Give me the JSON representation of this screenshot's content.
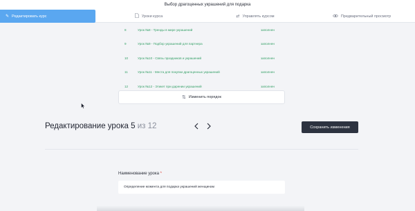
{
  "course_title": "Выбор драгоценных украшений для подарка",
  "tabs": [
    {
      "label": "Редактировать курс",
      "icon": "pencil-icon"
    },
    {
      "label": "Уроки курса",
      "icon": "document-icon"
    },
    {
      "label": "Управлять курсом",
      "icon": "swap-icon"
    },
    {
      "label": "Предварительный просмотр",
      "icon": "eye-icon"
    }
  ],
  "lessons": [
    {
      "num": "8",
      "title": "Урок №8 - Тренды в мире украшений",
      "status": "заполнен"
    },
    {
      "num": "9",
      "title": "Урок №9 - Подбор украшений для партнера",
      "status": "заполнен"
    },
    {
      "num": "10",
      "title": "Урок №10 - Связь праздников и украшений",
      "status": "заполнен"
    },
    {
      "num": "11",
      "title": "Урок №11 - Места для покупки драгоценных украшений",
      "status": "заполнен"
    },
    {
      "num": "12",
      "title": "Урок №12 - Этикет при дарении украшений",
      "status": "заполнен"
    }
  ],
  "reorder_label": "Изменить порядок",
  "editor": {
    "title_prefix": "Редактирование урока",
    "current": "5",
    "of_total": "из 12",
    "save_label": "Сохранить изменения"
  },
  "field": {
    "label": "Наименование урока",
    "required_mark": "*",
    "value": "Определение момента для подарка украшений женщинам"
  },
  "colors": {
    "accent": "#5aa7f0",
    "status_green": "#35a067",
    "dark_button": "#2d3340",
    "required": "#e0483e"
  }
}
